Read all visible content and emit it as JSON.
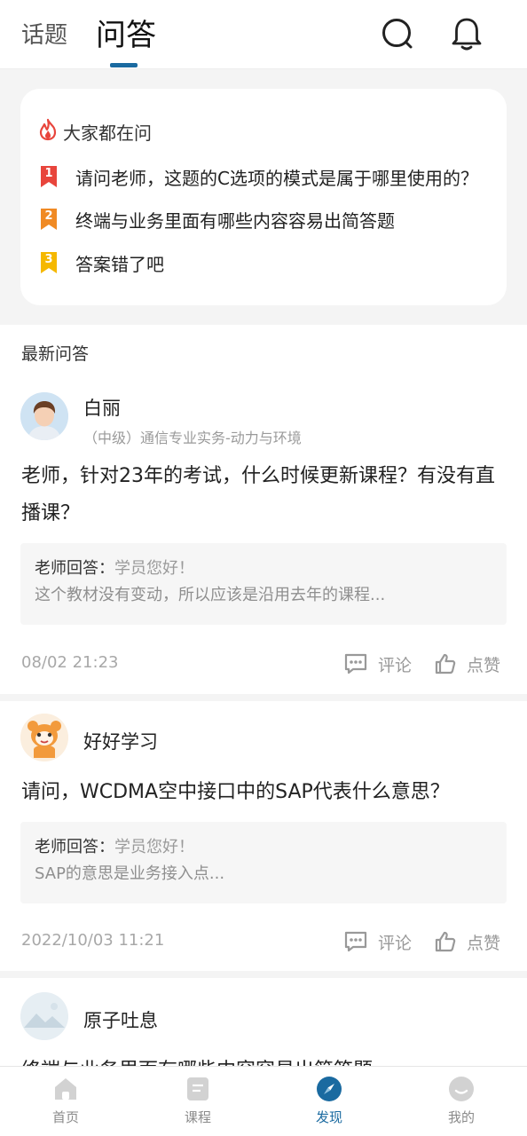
{
  "header": {
    "tab_topic": "话题",
    "tab_qa": "问答",
    "accent": "#1a6aa0"
  },
  "hot": {
    "title": "大家都在问",
    "items": [
      {
        "rank": "1",
        "text": "请问老师，这题的C选项的模式是属于哪里使用的？",
        "color": "#e8453c"
      },
      {
        "rank": "2",
        "text": "终端与业务里面有哪些内容容易出简答题",
        "color": "#f08a24"
      },
      {
        "rank": "3",
        "text": "答案错了吧",
        "color": "#f5b800"
      }
    ]
  },
  "latest": {
    "title": "最新问答",
    "posts": [
      {
        "username": "白丽",
        "subject": "（中级）通信专业实务-动力与环境",
        "question": " 老师，针对23年的考试，什么时候更新课程？有没有直播课？",
        "answer_label": "老师回答：",
        "answer_greet": "学员您好！",
        "answer_text": "这个教材没有变动，所以应该是沿用去年的课程...",
        "time": "08/02 21:23",
        "comment": "评论",
        "like": "点赞"
      },
      {
        "username": "好好学习",
        "subject": "",
        "question": " 请问，WCDMA空中接口中的SAP代表什么意思？",
        "answer_label": "老师回答：",
        "answer_greet": "学员您好！",
        "answer_text": "SAP的意思是业务接入点...",
        "time": "2022/10/03 11:21",
        "comment": "评论",
        "like": "点赞"
      },
      {
        "username": "原子吐息",
        "question_partial": "终端与业务里面有哪些内容容易出简答题"
      }
    ]
  },
  "nav": {
    "items": [
      {
        "label": "首页"
      },
      {
        "label": "课程"
      },
      {
        "label": "发现"
      },
      {
        "label": "我的"
      }
    ],
    "active_color": "#1a6aa0",
    "inactive_color": "#cfcfcf"
  }
}
